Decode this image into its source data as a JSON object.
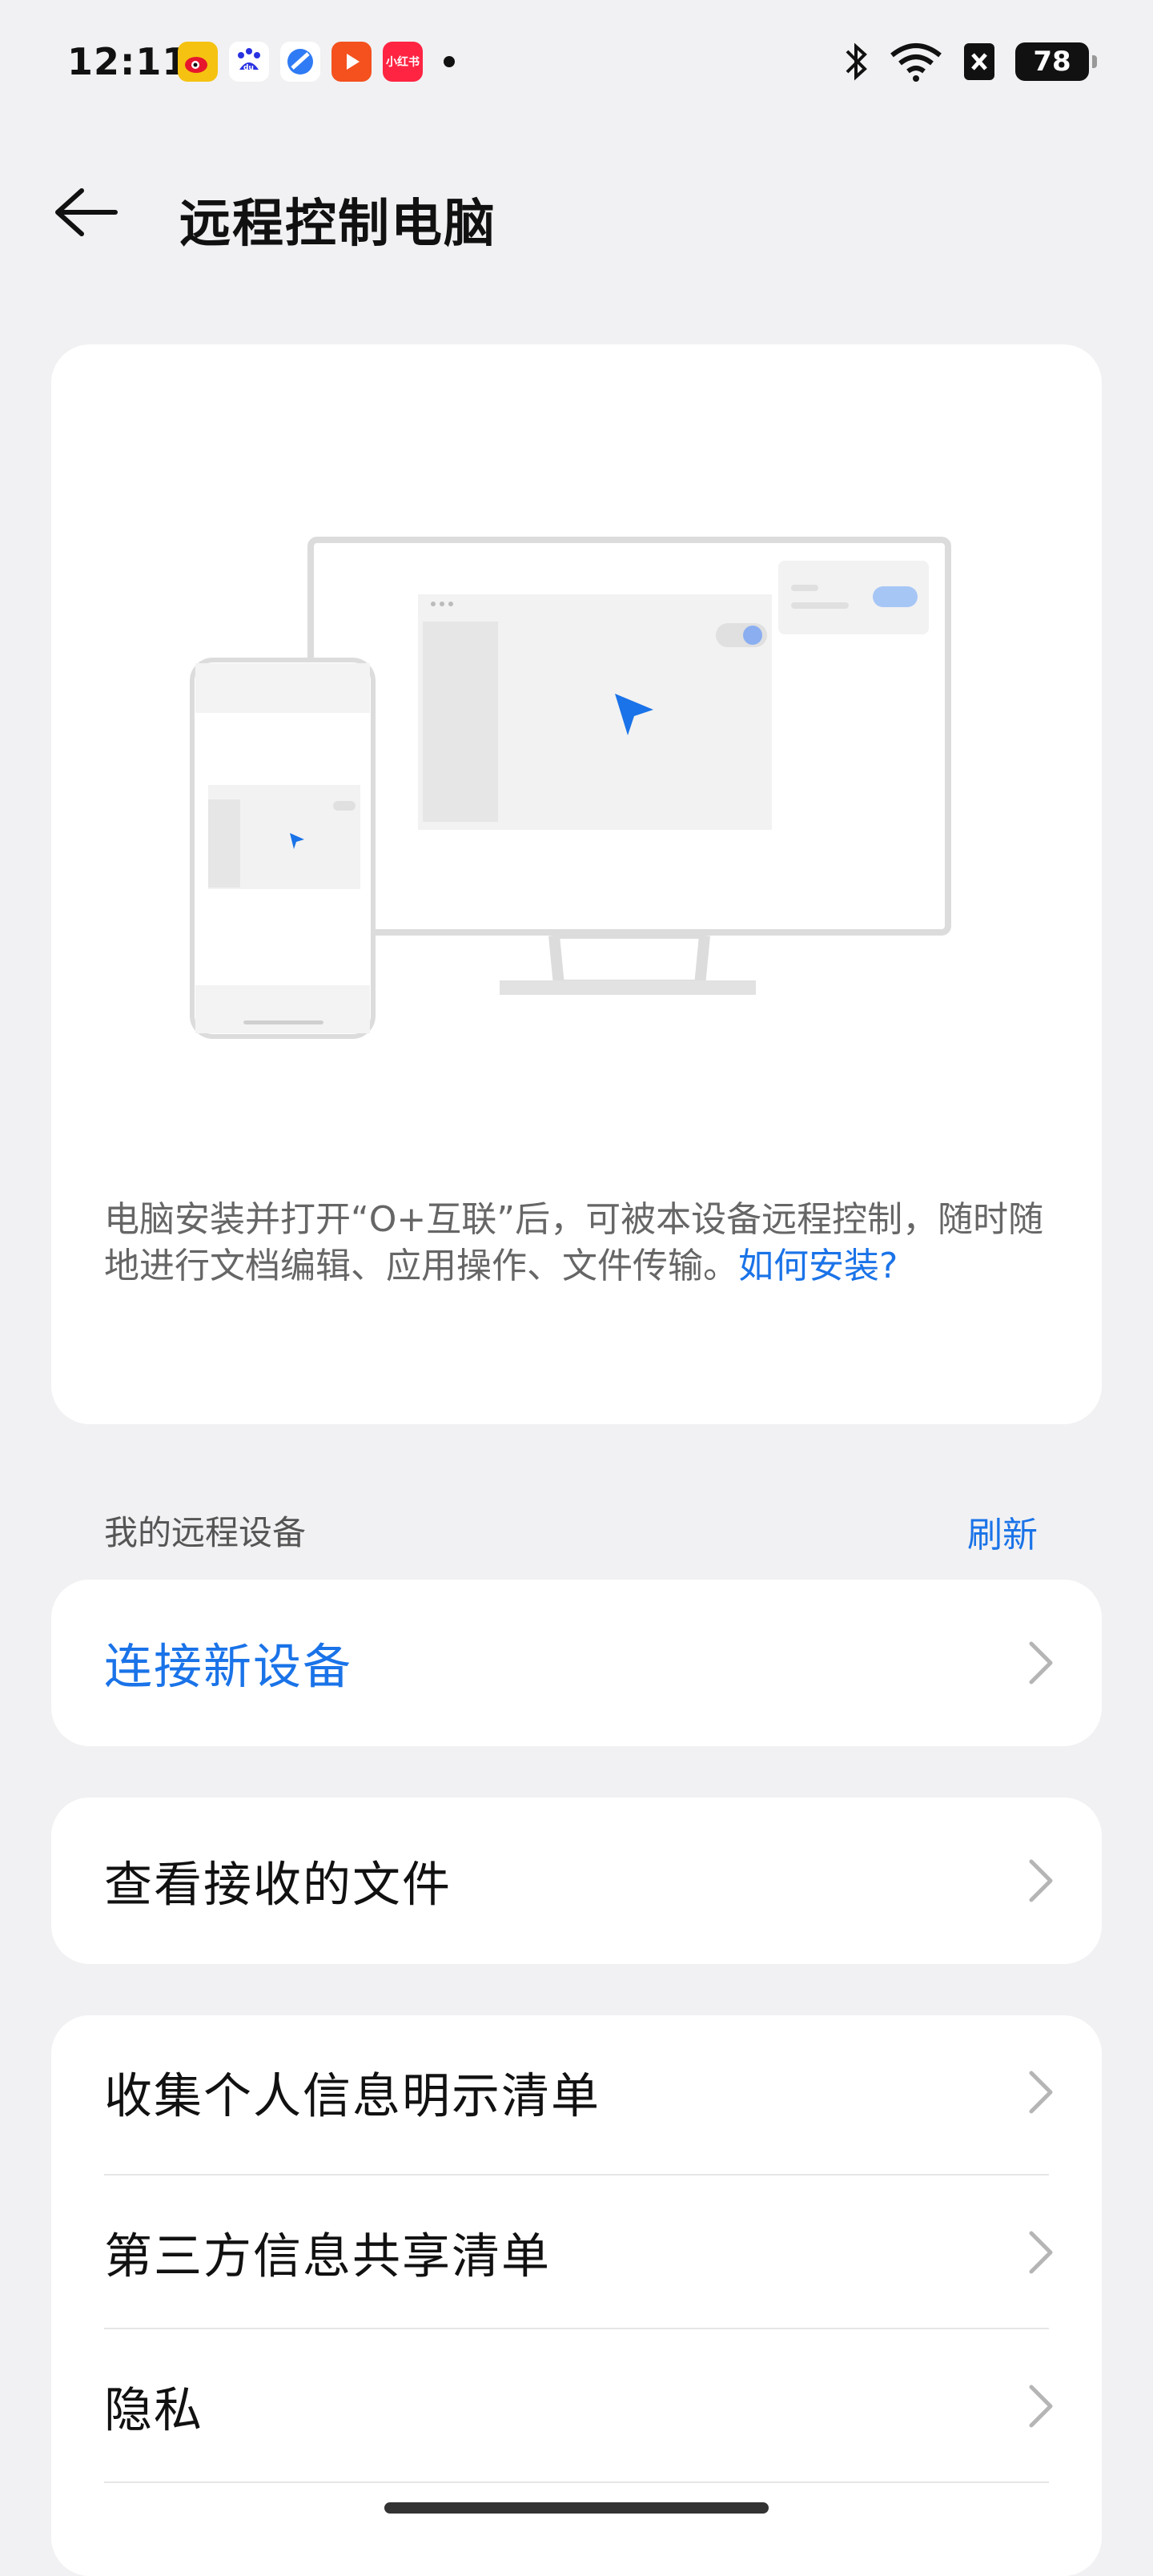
{
  "status_bar": {
    "time": "12:11",
    "notification_icons": [
      "weibo-icon",
      "baidu-icon",
      "browser-icon",
      "video-icon",
      "xiaohongshu-icon"
    ],
    "xiaohongshu_text": "小红书",
    "battery": "78"
  },
  "header": {
    "title": "远程控制电脑"
  },
  "hero": {
    "description": "电脑安装并打开“O+互联”后，可被本设备远程控制，随时随地进行文档编辑、应用操作、文件传输。",
    "link": "如何安装?"
  },
  "section": {
    "title": "我的远程设备",
    "refresh": "刷新"
  },
  "rows": {
    "connect": "连接新设备",
    "received_files": "查看接收的文件",
    "personal_info": "收集个人信息明示清单",
    "third_party": "第三方信息共享清单",
    "privacy": "隐私"
  },
  "colors": {
    "accent": "#1a73e8",
    "background": "#f1f1f3"
  }
}
